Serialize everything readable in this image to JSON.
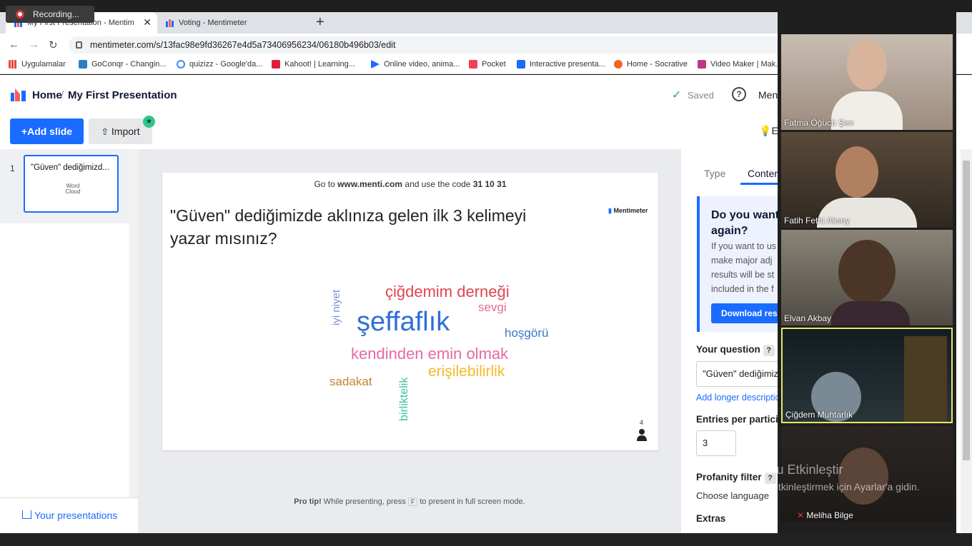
{
  "recording": {
    "label": "Recording..."
  },
  "tabs": [
    {
      "title": "My First Presentation - Mentimete",
      "active": true
    },
    {
      "title": "Voting - Mentimeter",
      "active": false
    }
  ],
  "address": {
    "url": "mentimeter.com/s/13fac98e9fd36267e4d5a73406956234/06180b496b03/edit"
  },
  "bookmarks": [
    {
      "label": "Uygulamalar",
      "color": "#e8453c"
    },
    {
      "label": "GoConqr - Changin...",
      "color": "#2f7ec1"
    },
    {
      "label": "quizizz - Google'da...",
      "color": "#4285f4"
    },
    {
      "label": "Kahoot! | Learning...",
      "color": "#e21b3c"
    },
    {
      "label": "Online video, anima...",
      "color": "#1f6bff"
    },
    {
      "label": "Pocket",
      "color": "#ef4056"
    },
    {
      "label": "Interactive presenta...",
      "color": "#196cff"
    },
    {
      "label": "Home - Socrative",
      "color": "#f26522"
    },
    {
      "label": "Video Maker | Mak...",
      "color": "#c13584"
    }
  ],
  "header": {
    "home": "Home",
    "separator": "/",
    "presentation": "My First Presentation",
    "saved": "Saved",
    "menu": "Men"
  },
  "toolbar": {
    "add_slide": "Add slide",
    "import": "Import",
    "extra": "E"
  },
  "slides_panel": {
    "number": "1",
    "thumb_title": "\"Güven\" dediğimizd...",
    "thumb_type": "Word Cloud",
    "your_presentations": "Your presentations"
  },
  "slide": {
    "join_prefix": "Go to ",
    "join_url": "www.menti.com",
    "join_middle": " and use the code ",
    "join_code": "31 10 31",
    "brand": "Mentimeter",
    "question": "\"Güven\" dediğimizde aklınıza gelen ilk 3 kelimeyi yazar mısınız?",
    "participants": "4",
    "words": [
      {
        "text": "çiğdemim derneği",
        "color": "#e0454f"
      },
      {
        "text": "sevgi",
        "color": "#e66b8f"
      },
      {
        "text": "iyi niyet",
        "color": "#7b8fd9"
      },
      {
        "text": "şeffaflık",
        "color": "#2f6fd6"
      },
      {
        "text": "hoşgörü",
        "color": "#3a78c9"
      },
      {
        "text": "kendinden emin olmak",
        "color": "#e56aa4"
      },
      {
        "text": "erişilebilirlik",
        "color": "#f2b92a"
      },
      {
        "text": "sadakat",
        "color": "#c9822a"
      },
      {
        "text": "birliktelik",
        "color": "#36c3a0"
      }
    ]
  },
  "protip": {
    "bold": "Pro tip!",
    "text1": " While presenting, press ",
    "key": "F",
    "text2": " to present in full screen mode."
  },
  "right_panel": {
    "tab_type": "Type",
    "tab_content": "Conter",
    "info_title": "Do you want again?",
    "info_text": "If you want to us make major adj results will be st included in the f",
    "download": "Download resu",
    "your_question_label": "Your question",
    "your_question_value": "\"Güven\" dediğimiz",
    "add_longer": "Add longer descriptio",
    "entries_label": "Entries per particip",
    "entries_value": "3",
    "profanity_label": "Profanity filter",
    "choose_language": "Choose language",
    "extras_label": "Extras"
  },
  "participants": [
    {
      "name": "Fatma Öğücü Şen",
      "bg": "#b8a89a",
      "muted": false,
      "active": false
    },
    {
      "name": "Fatih Fethi Aksoy",
      "bg": "#4a3f33",
      "muted": false,
      "active": false
    },
    {
      "name": "Elvan Akbay",
      "bg": "#6b6457",
      "muted": false,
      "active": false
    },
    {
      "name": "Çiğdem Muhtarlık",
      "bg": "#1e2a2e",
      "muted": false,
      "active": true
    },
    {
      "name": "Meliha Bilge",
      "bg": "#2b2623",
      "muted": true,
      "active": false
    }
  ],
  "watermark": {
    "title": "Windows'u Etkinleştir",
    "subtitle": "Windows'u etkinleştirmek için Ayarlar'a gidin."
  }
}
